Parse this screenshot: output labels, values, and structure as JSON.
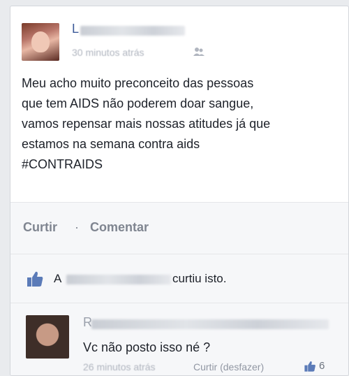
{
  "post": {
    "author_initial": "L",
    "time": "30 minutos atrás",
    "audience_icon": "friends-icon",
    "text": "Meu acho muito preconceito das pessoas\nque tem AIDS não poderem doar sangue,\nvamos repensar mais nossas atitudes já que\nestamos na semana contra aids\n#CONTRAIDS"
  },
  "actions": {
    "like_label": "Curtir",
    "separator": "·",
    "comment_label": "Comentar"
  },
  "likes": {
    "icon": "thumbs-up-icon",
    "liker_initial": "A",
    "suffix": "curtiu isto."
  },
  "comment": {
    "author_initial": "R",
    "text": "Vc não posto isso né ?",
    "time": "26 minutos atrás",
    "action": "Curtir (desfazer)",
    "like_count": "6"
  },
  "colors": {
    "link": "#3b5998",
    "muted": "#7f8590",
    "background": "#e9ebee"
  }
}
